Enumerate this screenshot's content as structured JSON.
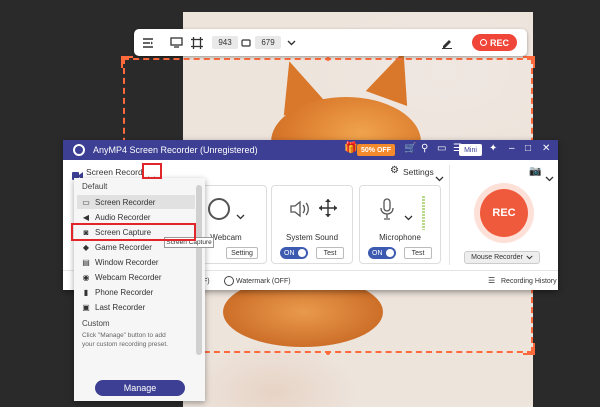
{
  "toolbar": {
    "width": "943",
    "height": "679",
    "rec_label": "REC"
  },
  "app": {
    "title": "AnyMP4 Screen Recorder (Unregistered)",
    "promo": "50% OFF",
    "mini_label": "Mini",
    "mode_label": "Screen Recorder",
    "settings_label": "Settings",
    "webcam": {
      "label": "Webcam",
      "setting_label": "Setting"
    },
    "system_sound": {
      "label": "System Sound",
      "toggle": "ON",
      "test_label": "Test"
    },
    "microphone": {
      "label": "Microphone",
      "toggle": "ON",
      "test_label": "Test"
    },
    "rec_label": "REC",
    "mouse_recorder_label": "Mouse Recorder",
    "watermark_label": "Watermark (OFF)",
    "history_label": "Recording History",
    "footer_left_fragment": "F)"
  },
  "dropdown": {
    "default_header": "Default",
    "items": [
      {
        "label": "Screen Recorder",
        "icon": "monitor-icon"
      },
      {
        "label": "Audio Recorder",
        "icon": "speaker-icon"
      },
      {
        "label": "Screen Capture",
        "icon": "camera-icon"
      },
      {
        "label": "Game Recorder",
        "icon": "gamepad-icon"
      },
      {
        "label": "Window Recorder",
        "icon": "window-icon"
      },
      {
        "label": "Webcam Recorder",
        "icon": "webcam-icon"
      },
      {
        "label": "Phone Recorder",
        "icon": "phone-icon"
      },
      {
        "label": "Last Recorder",
        "icon": "history-icon"
      }
    ],
    "custom_header": "Custom",
    "custom_hint_1": "Click \"Manage\" button to add",
    "custom_hint_2": "your custom recording preset.",
    "manage_label": "Manage",
    "tooltip": "Screen Capture"
  },
  "colors": {
    "accent": "#3c3f93",
    "rec": "#f05a3c",
    "highlight": "#e0262a",
    "selection": "#ff6a3d"
  }
}
